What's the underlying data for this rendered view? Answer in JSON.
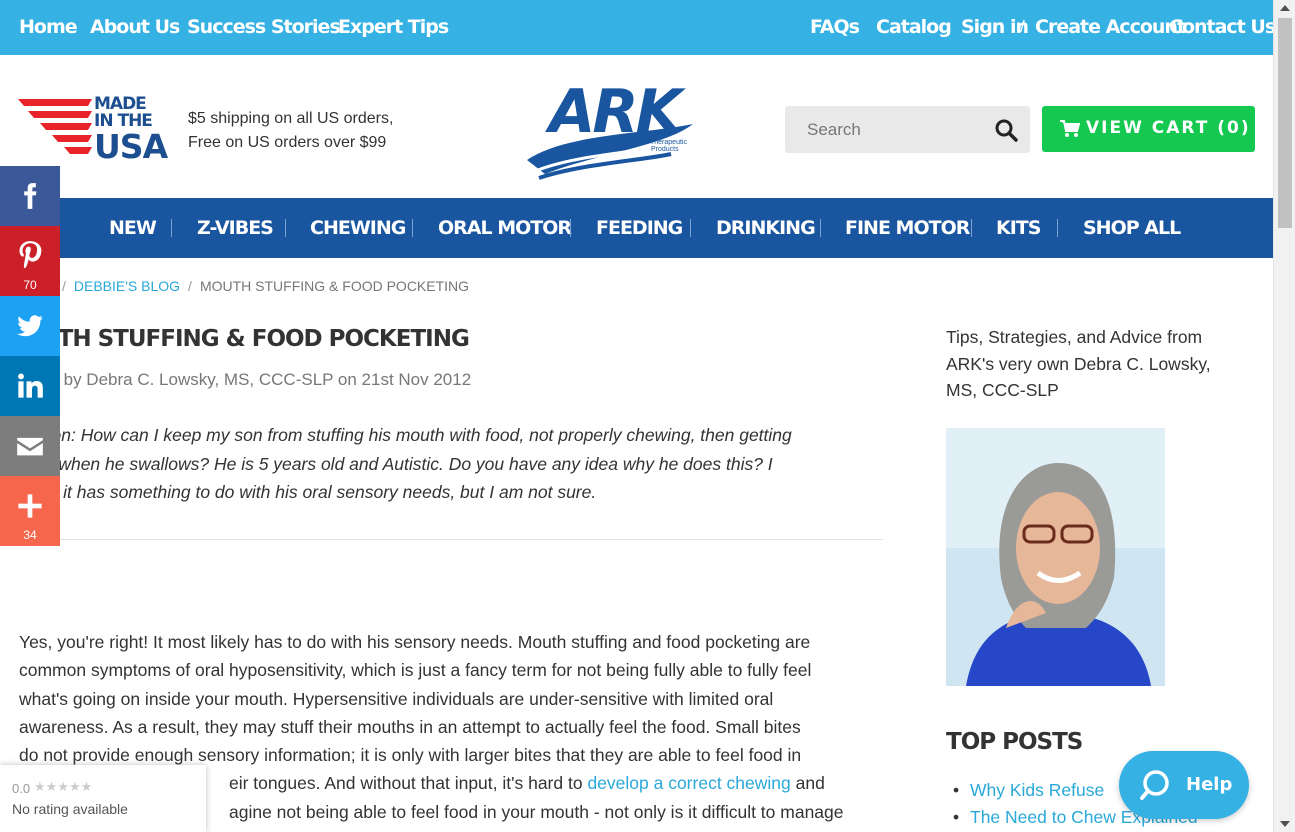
{
  "topbar": {
    "left_links": [
      "Home",
      "About Us",
      "Success Stories",
      "Expert Tips"
    ],
    "right_links": {
      "faqs": "FAQs",
      "catalog": "Catalog",
      "sign_in": "Sign in",
      "slash": "/",
      "create_account": "Create Account",
      "contact_us": "Contact Us"
    }
  },
  "header": {
    "badge": {
      "line1": "MADE",
      "line2": "IN THE",
      "line3": "USA"
    },
    "shipping_line1": "$5 shipping on all US orders,",
    "shipping_line2": "Free on US orders over $99",
    "logo": {
      "name": "ARK",
      "sub1": "Therapeutic",
      "sub2": "Products"
    },
    "search_placeholder": "Search",
    "cart_label": "VIEW CART (0)"
  },
  "nav": {
    "items": [
      "NEW",
      "Z-VIBES",
      "CHEWING",
      "ORAL MOTOR",
      "FEEDING",
      "DRINKING",
      "FINE MOTOR",
      "KITS",
      "SHOP ALL"
    ]
  },
  "share": {
    "pinterest_count": "70",
    "more_count": "34"
  },
  "breadcrumb": {
    "blog": "DEBBIE'S BLOG",
    "current": "MOUTH STUFFING & FOOD POCKETING",
    "sep": "/"
  },
  "post": {
    "title": "UTH STUFFING & FOOD POCKETING",
    "byline": "ed by Debra C. Lowsky, MS, CCC-SLP on 21st Nov 2012",
    "question_lines": [
      "stion:  How can I keep my son from stuffing his mouth with food, not properly chewing, then getting",
      "ed when he swallows?  He is 5 years old and Autistic.  Do you have any idea why he does this?  I",
      "me it has something to do with his oral sensory needs, but I am not sure."
    ],
    "answer_lines": [
      "Yes, you're right!  It most likely has to do with his sensory needs.  Mouth stuffing and food pocketing are",
      "common symptoms of oral hyposensitivity, which is just a fancy term for not being fully able to fully feel",
      "what's going on inside your mouth.  Hypersensitive individuals are under-sensitive with limited oral",
      "awareness.  As a result, they may stuff their mouths in an attempt to actually feel the food.  Small bites",
      "do not provide enough sensory information; it is only with larger bites that they are able to feel food in"
    ],
    "answer_line6_pre": "eir tongues.  And without that input, it's hard to ",
    "answer_line6_link": "develop a correct chewing",
    "answer_line6_post": " and",
    "answer_line7": "agine not being able to feel food in your mouth - not only is it difficult to manage"
  },
  "sidebar": {
    "intro": "Tips, Strategies, and Advice from ARK's very own Debra C. Lowsky, MS, CCC-SLP",
    "top_posts_heading": "TOP POSTS",
    "top_posts": [
      "Why Kids Refuse",
      "The Need to Chew Explained"
    ]
  },
  "rating": {
    "score": "0.0",
    "stars": "★★★★★",
    "label": "No rating available"
  },
  "help": {
    "label": "Help"
  },
  "colors": {
    "topbar": "#35b1e3",
    "nav": "#1a56a0",
    "cart": "#14c850",
    "link": "#2aa8d8"
  },
  "icons": [
    "search-icon",
    "cart-icon",
    "facebook-icon",
    "pinterest-icon",
    "twitter-icon",
    "linkedin-icon",
    "email-icon",
    "plus-icon",
    "help-search-icon"
  ]
}
